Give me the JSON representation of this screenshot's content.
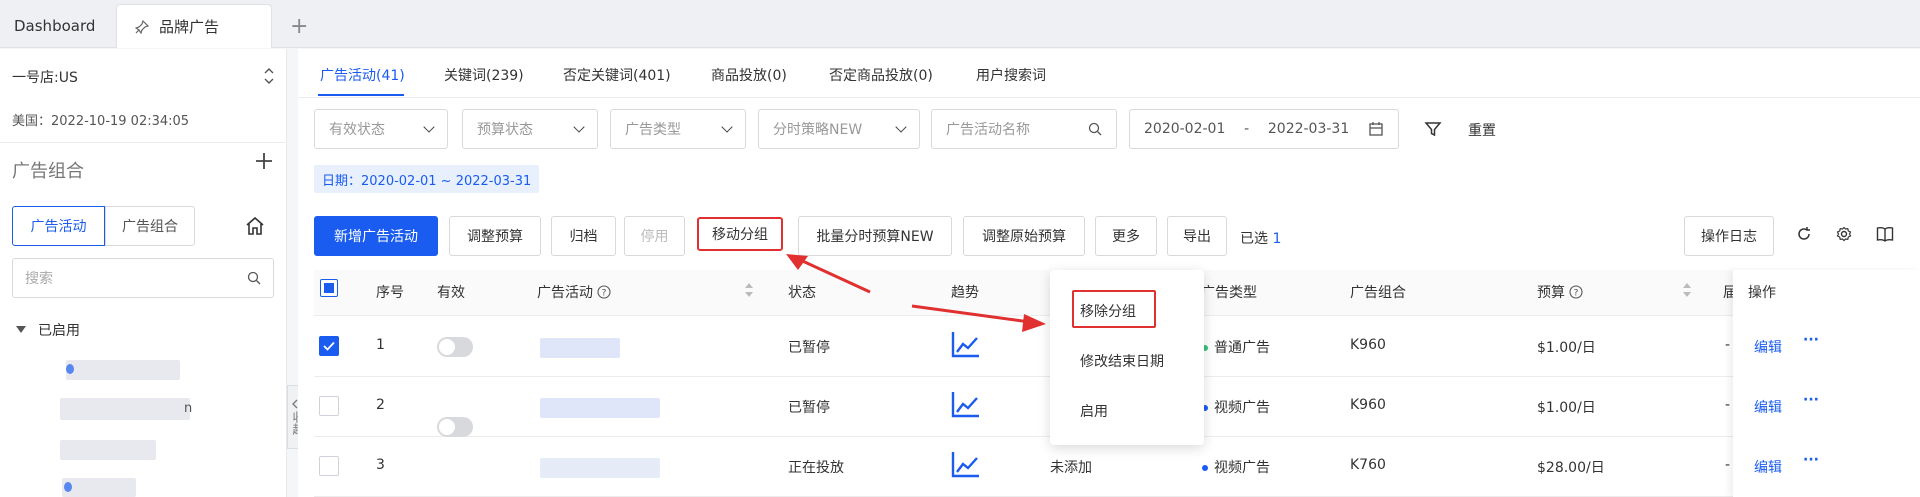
{
  "tabs": {
    "dashboard": "Dashboard",
    "active": "品牌广告",
    "add": "+"
  },
  "sidebar": {
    "shop": "一号店:US",
    "time": "美国：2022-10-19 02:34:05",
    "title": "广告组合",
    "seg_campaign": "广告活动",
    "seg_portfolio": "广告组合",
    "search_placeholder": "搜索",
    "tree_head": "已启用",
    "tree_partial": "n",
    "collapse": "收起"
  },
  "subtabs": [
    {
      "label": "广告活动(41)"
    },
    {
      "label": "关键词(239)"
    },
    {
      "label": "否定关键词(401)"
    },
    {
      "label": "商品投放(0)"
    },
    {
      "label": "否定商品投放(0)"
    },
    {
      "label": "用户搜索词"
    }
  ],
  "filters": {
    "status": "有效状态",
    "budget_status": "预算状态",
    "ad_type": "广告类型",
    "strategy": "分时策略NEW",
    "name_placeholder": "广告活动名称",
    "date_start": "2020-02-01",
    "date_sep": "-",
    "date_end": "2022-03-31",
    "reset": "重置",
    "date_tag": "日期：2020-02-01 ~ 2022-03-31"
  },
  "toolbar": {
    "add": "新增广告活动",
    "adjust_budget": "调整预算",
    "archive": "归档",
    "pause": "停用",
    "move_group": "移动分组",
    "batch_budget": "批量分时预算NEW",
    "adjust_original": "调整原始预算",
    "more": "更多",
    "export": "导出",
    "selected_label": "已选",
    "selected_count": "1",
    "log": "操作日志"
  },
  "table": {
    "headers": {
      "index": "序号",
      "valid": "有效",
      "campaign": "广告活动",
      "state": "状态",
      "trend": "趋势",
      "ad_type": "广告类型",
      "portfolio": "广告组合",
      "budget": "预算",
      "cut": "届",
      "ops": "操作"
    },
    "rows": [
      {
        "index": "1",
        "checked": true,
        "enabled": false,
        "state": "已暂停",
        "group": "",
        "ad_type": "普通广告",
        "type_color": "#35c27a",
        "portfolio": "K960",
        "budget": "$1.00/日",
        "extra": "-",
        "edit": "编辑",
        "more": "···"
      },
      {
        "index": "2",
        "checked": false,
        "enabled": false,
        "state": "已暂停",
        "group": "",
        "ad_type": "视频广告",
        "type_color": "#1a5cf0",
        "portfolio": "K960",
        "budget": "$1.00/日",
        "extra": "-",
        "edit": "编辑",
        "more": "···"
      },
      {
        "index": "3",
        "checked": false,
        "enabled": true,
        "state": "正在投放",
        "group": "未添加",
        "ad_type": "视频广告",
        "type_color": "#1a5cf0",
        "portfolio": "K760",
        "budget": "$28.00/日",
        "extra": "-",
        "edit": "编辑",
        "more": "···"
      }
    ]
  },
  "dropdown": {
    "items": [
      "移除分组",
      "修改结束日期",
      "启用"
    ]
  },
  "colors": {
    "accent": "#1a5cf0",
    "highlight": "#e03030",
    "green": "#35c27a"
  }
}
